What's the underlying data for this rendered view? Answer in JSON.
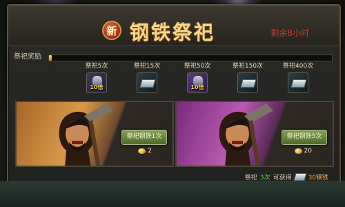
{
  "header": {
    "badge": "新",
    "title": "钢铁祭祀",
    "remaining": "剩余8小时"
  },
  "progress": {
    "label": "祭祀奖励",
    "fraction": 0.01
  },
  "milestones": [
    {
      "label": "祭祀5次",
      "icon": "bag-icon",
      "badge": "10倍"
    },
    {
      "label": "祭祀15次",
      "icon": "steel-icon",
      "badge": ""
    },
    {
      "label": "祭祀50次",
      "icon": "bag-icon",
      "badge": "10倍"
    },
    {
      "label": "祭祀150次",
      "icon": "steel-icon",
      "badge": ""
    },
    {
      "label": "祭祀400次",
      "icon": "steel-icon",
      "badge": ""
    }
  ],
  "cards": [
    {
      "button": "祭祀钢铁1次",
      "cost": "2"
    },
    {
      "button": "祭祀钢铁5次",
      "cost": "20"
    }
  ],
  "footer": {
    "prefix": "祭祀",
    "count": "3次",
    "middle": "可获得",
    "reward": "30钢铁"
  },
  "colors": {
    "title": "#f6d887",
    "remaining": "#d83224",
    "highlight": "#62d64c",
    "reward": "#ffb034",
    "button": "#6e8a44"
  }
}
